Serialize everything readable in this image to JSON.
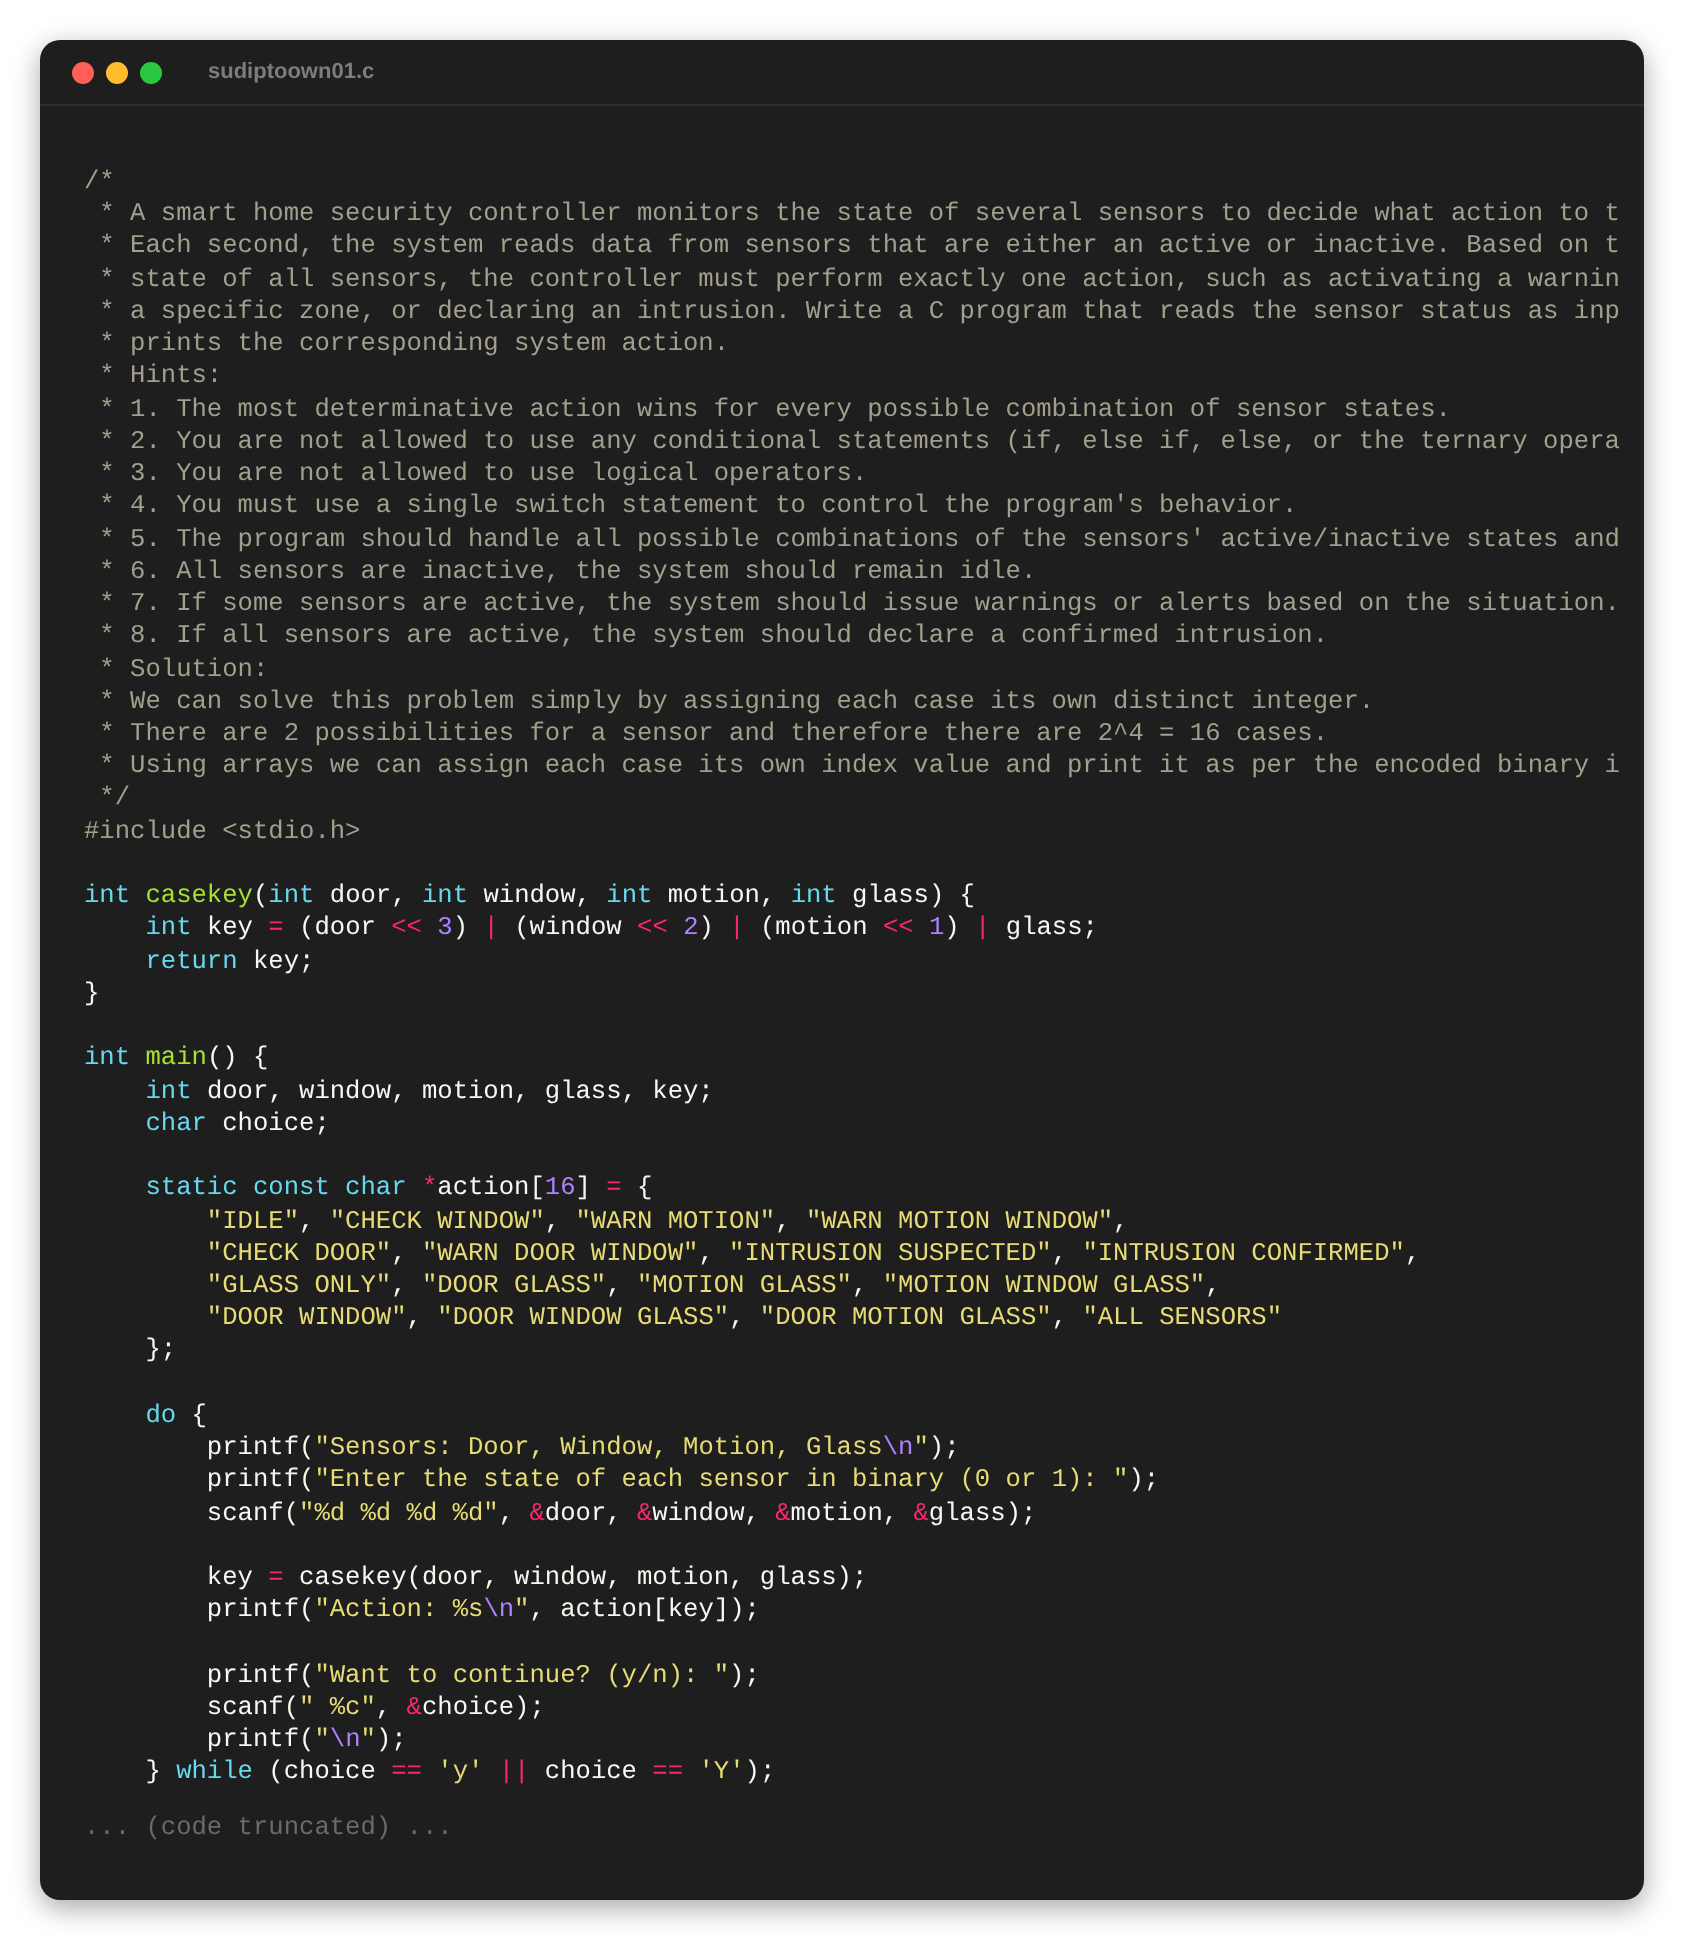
{
  "window": {
    "title": "sudiptoown01.c"
  },
  "code_blocks": [
    [
      [
        {
          "text": "/*",
          "kind": "comment"
        }
      ],
      [
        {
          "text": " * A smart home security controller monitors the state of several sensors to decide what action to t",
          "kind": "comment"
        }
      ],
      [
        {
          "text": " * Each second, the system reads data from sensors that are either an active or inactive. Based on t",
          "kind": "comment"
        }
      ],
      [
        {
          "text": " * state of all sensors, the controller must perform exactly one action, such as activating a warnin",
          "kind": "comment"
        }
      ],
      [
        {
          "text": " * a specific zone, or declaring an intrusion. Write a C program that reads the sensor status as inp",
          "kind": "comment"
        }
      ],
      [
        {
          "text": " * prints the corresponding system action.",
          "kind": "comment"
        }
      ],
      [
        {
          "text": " * Hints:",
          "kind": "comment"
        }
      ],
      [
        {
          "text": " * 1. The most determinative action wins for every possible combination of sensor states.",
          "kind": "comment"
        }
      ],
      [
        {
          "text": " * 2. You are not allowed to use any conditional statements (if, else if, else, or the ternary opera",
          "kind": "comment"
        }
      ],
      [
        {
          "text": " * 3. You are not allowed to use logical operators.",
          "kind": "comment"
        }
      ],
      [
        {
          "text": " * 4. You must use a single switch statement to control the program's behavior.",
          "kind": "comment"
        }
      ],
      [
        {
          "text": " * 5. The program should handle all possible combinations of the sensors' active/inactive states and",
          "kind": "comment"
        }
      ],
      [
        {
          "text": " * 6. All sensors are inactive, the system should remain idle.",
          "kind": "comment"
        }
      ],
      [
        {
          "text": " * 7. If some sensors are active, the system should issue warnings or alerts based on the situation.",
          "kind": "comment"
        }
      ],
      [
        {
          "text": " * 8. If all sensors are active, the system should declare a confirmed intrusion.",
          "kind": "comment"
        }
      ],
      [
        {
          "text": " * Solution:",
          "kind": "comment"
        }
      ],
      [
        {
          "text": " * We can solve this problem simply by assigning each case its own distinct integer.",
          "kind": "comment"
        }
      ],
      [
        {
          "text": " * There are 2 possibilities for a sensor and therefore there are 2^4 = 16 cases.",
          "kind": "comment"
        }
      ],
      [
        {
          "text": " * Using arrays we can assign each case its own index value and print it as per the encoded binary i",
          "kind": "comment"
        }
      ],
      [
        {
          "text": " */",
          "kind": "comment"
        }
      ],
      [
        {
          "text": "#include <stdio.h>",
          "kind": "comment"
        }
      ]
    ],
    [
      [
        {
          "text": "int ",
          "kind": "keyword"
        },
        {
          "text": "casekey",
          "kind": "function"
        },
        {
          "text": "(",
          "kind": "plain"
        },
        {
          "text": "int",
          "kind": "keyword"
        },
        {
          "text": " door, ",
          "kind": "plain"
        },
        {
          "text": "int",
          "kind": "keyword"
        },
        {
          "text": " window, ",
          "kind": "plain"
        },
        {
          "text": "int",
          "kind": "keyword"
        },
        {
          "text": " motion, ",
          "kind": "plain"
        },
        {
          "text": "int",
          "kind": "keyword"
        },
        {
          "text": " glass) {",
          "kind": "plain"
        }
      ],
      [
        {
          "text": "    int",
          "kind": "keyword"
        },
        {
          "text": " key ",
          "kind": "plain"
        },
        {
          "text": "=",
          "kind": "operator"
        },
        {
          "text": " (door ",
          "kind": "plain"
        },
        {
          "text": "<< ",
          "kind": "operator"
        },
        {
          "text": "3",
          "kind": "number"
        },
        {
          "text": ") ",
          "kind": "plain"
        },
        {
          "text": "|",
          "kind": "operator"
        },
        {
          "text": " (window ",
          "kind": "plain"
        },
        {
          "text": "<< ",
          "kind": "operator"
        },
        {
          "text": "2",
          "kind": "number"
        },
        {
          "text": ") ",
          "kind": "plain"
        },
        {
          "text": "|",
          "kind": "operator"
        },
        {
          "text": " (motion ",
          "kind": "plain"
        },
        {
          "text": "<< ",
          "kind": "operator"
        },
        {
          "text": "1",
          "kind": "number"
        },
        {
          "text": ") ",
          "kind": "plain"
        },
        {
          "text": "|",
          "kind": "operator"
        },
        {
          "text": " glass;",
          "kind": "plain"
        }
      ],
      [
        {
          "text": "    return",
          "kind": "keyword"
        },
        {
          "text": " key;",
          "kind": "plain"
        }
      ],
      [
        {
          "text": "}",
          "kind": "plain"
        }
      ]
    ],
    [
      [
        {
          "text": "int ",
          "kind": "keyword"
        },
        {
          "text": "main",
          "kind": "function"
        },
        {
          "text": "() {",
          "kind": "plain"
        }
      ],
      [
        {
          "text": "    int",
          "kind": "keyword"
        },
        {
          "text": " door, window, motion, glass, key;",
          "kind": "plain"
        }
      ],
      [
        {
          "text": "    char",
          "kind": "keyword"
        },
        {
          "text": " choice;",
          "kind": "plain"
        }
      ]
    ],
    [
      [
        {
          "text": "    static const char ",
          "kind": "keyword"
        },
        {
          "text": "*",
          "kind": "operator"
        },
        {
          "text": "action[",
          "kind": "plain"
        },
        {
          "text": "16",
          "kind": "number"
        },
        {
          "text": "] ",
          "kind": "plain"
        },
        {
          "text": "=",
          "kind": "operator"
        },
        {
          "text": " {",
          "kind": "plain"
        }
      ],
      [
        {
          "text": "        \"IDLE\"",
          "kind": "string"
        },
        {
          "text": ", ",
          "kind": "plain"
        },
        {
          "text": "\"CHECK WINDOW\"",
          "kind": "string"
        },
        {
          "text": ", ",
          "kind": "plain"
        },
        {
          "text": "\"WARN MOTION\"",
          "kind": "string"
        },
        {
          "text": ", ",
          "kind": "plain"
        },
        {
          "text": "\"WARN MOTION WINDOW\"",
          "kind": "string"
        },
        {
          "text": ",",
          "kind": "plain"
        }
      ],
      [
        {
          "text": "        \"CHECK DOOR\"",
          "kind": "string"
        },
        {
          "text": ", ",
          "kind": "plain"
        },
        {
          "text": "\"WARN DOOR WINDOW\"",
          "kind": "string"
        },
        {
          "text": ", ",
          "kind": "plain"
        },
        {
          "text": "\"INTRUSION SUSPECTED\"",
          "kind": "string"
        },
        {
          "text": ", ",
          "kind": "plain"
        },
        {
          "text": "\"INTRUSION CONFIRMED\"",
          "kind": "string"
        },
        {
          "text": ",",
          "kind": "plain"
        }
      ],
      [
        {
          "text": "        \"GLASS ONLY\"",
          "kind": "string"
        },
        {
          "text": ", ",
          "kind": "plain"
        },
        {
          "text": "\"DOOR GLASS\"",
          "kind": "string"
        },
        {
          "text": ", ",
          "kind": "plain"
        },
        {
          "text": "\"MOTION GLASS\"",
          "kind": "string"
        },
        {
          "text": ", ",
          "kind": "plain"
        },
        {
          "text": "\"MOTION WINDOW GLASS\"",
          "kind": "string"
        },
        {
          "text": ",",
          "kind": "plain"
        }
      ],
      [
        {
          "text": "        \"DOOR WINDOW\"",
          "kind": "string"
        },
        {
          "text": ", ",
          "kind": "plain"
        },
        {
          "text": "\"DOOR WINDOW GLASS\"",
          "kind": "string"
        },
        {
          "text": ", ",
          "kind": "plain"
        },
        {
          "text": "\"DOOR MOTION GLASS\"",
          "kind": "string"
        },
        {
          "text": ", ",
          "kind": "plain"
        },
        {
          "text": "\"ALL SENSORS\"",
          "kind": "string"
        }
      ],
      [
        {
          "text": "    };",
          "kind": "plain"
        }
      ]
    ],
    [
      [
        {
          "text": "    do",
          "kind": "keyword"
        },
        {
          "text": " {",
          "kind": "plain"
        }
      ],
      [
        {
          "text": "        printf(",
          "kind": "plain"
        },
        {
          "text": "\"Sensors: Door, Window, Motion, Glass",
          "kind": "string"
        },
        {
          "text": "\\n",
          "kind": "number"
        },
        {
          "text": "\"",
          "kind": "string"
        },
        {
          "text": ");",
          "kind": "plain"
        }
      ],
      [
        {
          "text": "        printf(",
          "kind": "plain"
        },
        {
          "text": "\"Enter the state of each sensor in binary (0 or 1): \"",
          "kind": "string"
        },
        {
          "text": ");",
          "kind": "plain"
        }
      ],
      [
        {
          "text": "        scanf(",
          "kind": "plain"
        },
        {
          "text": "\"%d %d %d %d\"",
          "kind": "string"
        },
        {
          "text": ", ",
          "kind": "plain"
        },
        {
          "text": "&",
          "kind": "operator"
        },
        {
          "text": "door, ",
          "kind": "plain"
        },
        {
          "text": "&",
          "kind": "operator"
        },
        {
          "text": "window, ",
          "kind": "plain"
        },
        {
          "text": "&",
          "kind": "operator"
        },
        {
          "text": "motion, ",
          "kind": "plain"
        },
        {
          "text": "&",
          "kind": "operator"
        },
        {
          "text": "glass);",
          "kind": "plain"
        }
      ]
    ],
    [
      [
        {
          "text": "        key ",
          "kind": "plain"
        },
        {
          "text": "=",
          "kind": "operator"
        },
        {
          "text": " casekey(door, window, motion, glass);",
          "kind": "plain"
        }
      ],
      [
        {
          "text": "        printf(",
          "kind": "plain"
        },
        {
          "text": "\"Action: %s",
          "kind": "string"
        },
        {
          "text": "\\n",
          "kind": "number"
        },
        {
          "text": "\"",
          "kind": "string"
        },
        {
          "text": ", action[key]);",
          "kind": "plain"
        }
      ]
    ],
    [
      [
        {
          "text": "        printf(",
          "kind": "plain"
        },
        {
          "text": "\"Want to continue? (y/n): \"",
          "kind": "string"
        },
        {
          "text": ");",
          "kind": "plain"
        }
      ],
      [
        {
          "text": "        scanf(",
          "kind": "plain"
        },
        {
          "text": "\" %c\"",
          "kind": "string"
        },
        {
          "text": ", ",
          "kind": "plain"
        },
        {
          "text": "&",
          "kind": "operator"
        },
        {
          "text": "choice);",
          "kind": "plain"
        }
      ],
      [
        {
          "text": "        printf(",
          "kind": "plain"
        },
        {
          "text": "\"",
          "kind": "string"
        },
        {
          "text": "\\n",
          "kind": "number"
        },
        {
          "text": "\"",
          "kind": "string"
        },
        {
          "text": ");",
          "kind": "plain"
        }
      ],
      [
        {
          "text": "    } ",
          "kind": "plain"
        },
        {
          "text": "while",
          "kind": "keyword"
        },
        {
          "text": " (choice ",
          "kind": "plain"
        },
        {
          "text": "== ",
          "kind": "operator"
        },
        {
          "text": "'y' ",
          "kind": "string"
        },
        {
          "text": "||",
          "kind": "operator"
        },
        {
          "text": " choice ",
          "kind": "plain"
        },
        {
          "text": "== ",
          "kind": "operator"
        },
        {
          "text": "'Y'",
          "kind": "string"
        },
        {
          "text": ");",
          "kind": "plain"
        }
      ]
    ]
  ],
  "truncation_note": "... (code truncated) ..."
}
